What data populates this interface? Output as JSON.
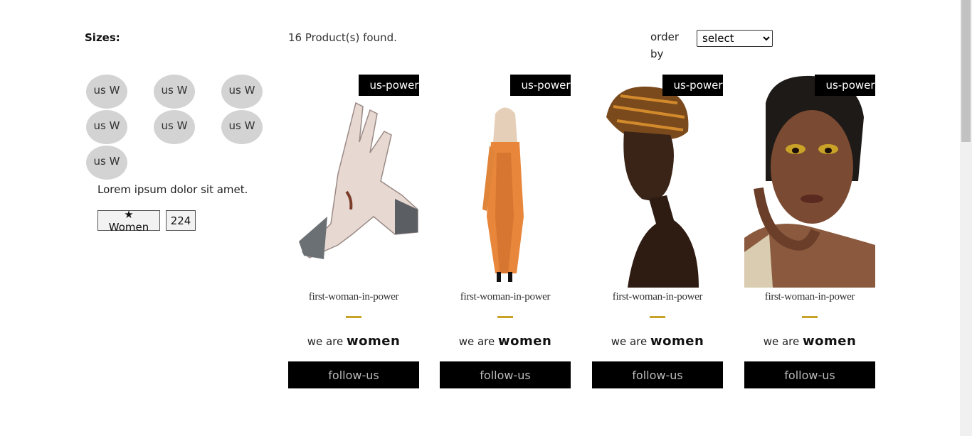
{
  "sidebar": {
    "sizes_title": "Sizes:",
    "size_options": [
      "us W",
      "us W",
      "us W",
      "us W",
      "us W",
      "us W",
      "us W"
    ],
    "description": "Lorem ipsum dolor sit amet.",
    "filter_tag": "★ Women",
    "filter_count": "224"
  },
  "header": {
    "results": "16 Product(s) found.",
    "order_label": "order by",
    "order_select": "select"
  },
  "products": [
    {
      "badge": "us-power",
      "title": "first-woman-in-power",
      "tagline_prefix": "we are",
      "tagline_bold": "women",
      "button": "follow-us",
      "image": "clapping-hands"
    },
    {
      "badge": "us-power",
      "title": "first-woman-in-power",
      "tagline_prefix": "we are",
      "tagline_bold": "women",
      "button": "follow-us",
      "image": "woman-orange-dress"
    },
    {
      "badge": "us-power",
      "title": "first-woman-in-power",
      "tagline_prefix": "we are",
      "tagline_bold": "women",
      "button": "follow-us",
      "image": "woman-head-wrap"
    },
    {
      "badge": "us-power",
      "title": "first-woman-in-power",
      "tagline_prefix": "we are",
      "tagline_bold": "women",
      "button": "follow-us",
      "image": "woman-portrait"
    }
  ],
  "colors": {
    "accent_gold": "#c9a227",
    "badge_bg": "#000000",
    "chip_bg": "#d3d3d3"
  }
}
